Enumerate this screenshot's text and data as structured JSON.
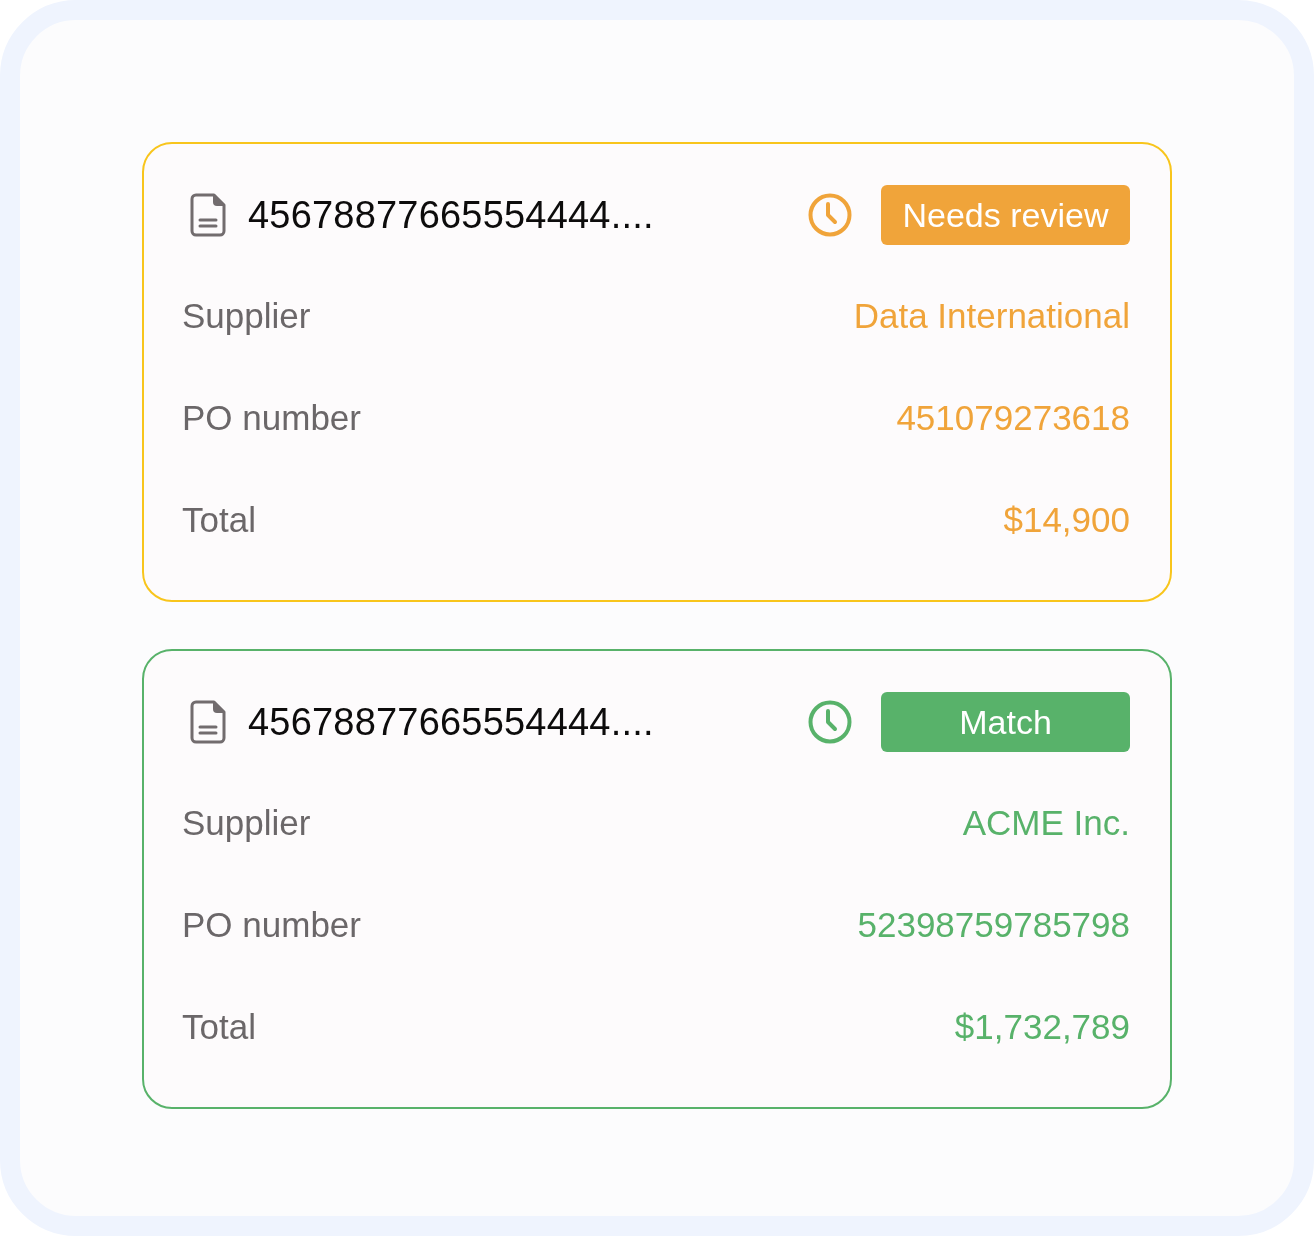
{
  "cards": [
    {
      "kind": "review",
      "document_number": "45678877665554444....",
      "status": "Needs review",
      "fields": [
        {
          "label": "Supplier",
          "value": "Data International"
        },
        {
          "label": "PO number",
          "value": "451079273618"
        },
        {
          "label": "Total",
          "value": "$14,900"
        }
      ]
    },
    {
      "kind": "match",
      "document_number": "45678877665554444....",
      "status": "Match",
      "fields": [
        {
          "label": "Supplier",
          "value": "ACME Inc."
        },
        {
          "label": "PO number",
          "value": "52398759785798"
        },
        {
          "label": "Total",
          "value": "$1,732,789"
        }
      ]
    }
  ]
}
